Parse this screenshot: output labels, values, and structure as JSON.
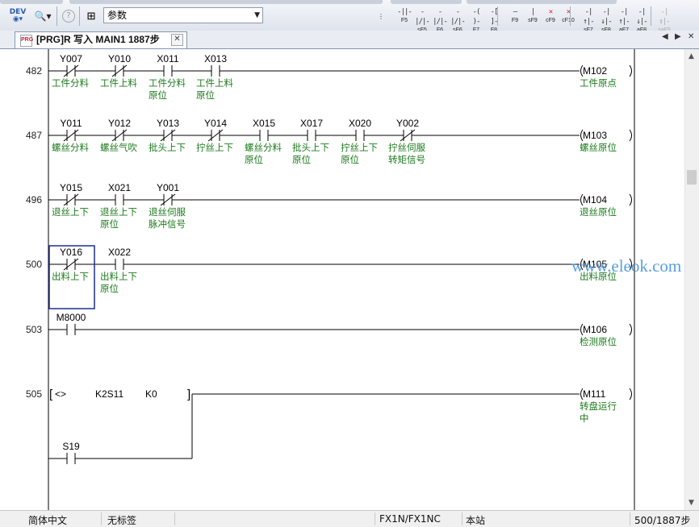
{
  "toolbar": {
    "device_icon_label": "DEV",
    "search_scope_value": "参数",
    "fkeys": [
      {
        "id": "f5",
        "label": "F5",
        "sym": "-||-"
      },
      {
        "id": "sf5",
        "label": "sF5",
        "sym": "-|/|-"
      },
      {
        "id": "f6",
        "label": "F6",
        "sym": "-|/|-"
      },
      {
        "id": "sf6",
        "label": "sF6",
        "sym": "-|/|-"
      },
      {
        "id": "f7",
        "label": "F7",
        "sym": "-( )-"
      },
      {
        "id": "f8",
        "label": "F8",
        "sym": "-[ ]-"
      },
      {
        "id": "f9",
        "label": "F9",
        "sym": "—"
      },
      {
        "id": "sf9",
        "label": "sF9",
        "sym": "|"
      },
      {
        "id": "cf9",
        "label": "cF9",
        "sym": "✕"
      },
      {
        "id": "cf10",
        "label": "cF10",
        "sym": "✕"
      },
      {
        "id": "sf7",
        "label": "sF7",
        "sym": "-|↑|-"
      },
      {
        "id": "sf8",
        "label": "sF8",
        "sym": "-|↓|-"
      },
      {
        "id": "af7",
        "label": "aF7",
        "sym": "-|↑|-"
      },
      {
        "id": "af8",
        "label": "aF8",
        "sym": "-|↓|-"
      },
      {
        "id": "saf5",
        "label": "saF5",
        "sym": "-|↕|-"
      }
    ]
  },
  "tab": {
    "title": "[PRG]R 写入 MAIN1 1887步"
  },
  "ladder": {
    "rungs": [
      {
        "step": "482",
        "coil": "M102",
        "coil_comment": [
          "工件原点"
        ],
        "contacts": [
          {
            "dev": "Y007",
            "nc": true,
            "comment": [
              "工件分料"
            ]
          },
          {
            "dev": "Y010",
            "nc": true,
            "comment": [
              "工件上料"
            ]
          },
          {
            "dev": "X011",
            "nc": false,
            "comment": [
              "工件分料",
              "原位"
            ]
          },
          {
            "dev": "X013",
            "nc": false,
            "comment": [
              "工件上料",
              "原位"
            ]
          }
        ]
      },
      {
        "step": "487",
        "coil": "M103",
        "coil_comment": [
          "螺丝原位"
        ],
        "contacts": [
          {
            "dev": "Y011",
            "nc": true,
            "comment": [
              "螺丝分料"
            ]
          },
          {
            "dev": "Y012",
            "nc": true,
            "comment": [
              "螺丝气吹"
            ]
          },
          {
            "dev": "Y013",
            "nc": true,
            "comment": [
              "批头上下"
            ]
          },
          {
            "dev": "Y014",
            "nc": true,
            "comment": [
              "拧丝上下"
            ]
          },
          {
            "dev": "X015",
            "nc": false,
            "comment": [
              "螺丝分料",
              "原位"
            ]
          },
          {
            "dev": "X017",
            "nc": false,
            "comment": [
              "批头上下",
              "原位"
            ]
          },
          {
            "dev": "X020",
            "nc": false,
            "comment": [
              "拧丝上下",
              "原位"
            ]
          },
          {
            "dev": "Y002",
            "nc": true,
            "comment": [
              "拧丝伺服",
              "转矩信号"
            ]
          }
        ]
      },
      {
        "step": "496",
        "coil": "M104",
        "coil_comment": [
          "退丝原位"
        ],
        "contacts": [
          {
            "dev": "Y015",
            "nc": true,
            "comment": [
              "退丝上下"
            ]
          },
          {
            "dev": "X021",
            "nc": false,
            "comment": [
              "退丝上下",
              "原位"
            ]
          },
          {
            "dev": "Y001",
            "nc": true,
            "comment": [
              "退丝伺服",
              "脉冲信号"
            ]
          }
        ]
      },
      {
        "step": "500",
        "coil": "M105",
        "coil_comment": [
          "出料原位"
        ],
        "contacts": [
          {
            "dev": "Y016",
            "nc": true,
            "comment": [
              "出料上下"
            ]
          },
          {
            "dev": "X022",
            "nc": false,
            "comment": [
              "出料上下",
              "原位"
            ]
          }
        ]
      },
      {
        "step": "503",
        "coil": "M106",
        "coil_comment": [
          "检测原位"
        ],
        "contacts": [
          {
            "dev": "M8000",
            "nc": false,
            "comment": []
          }
        ]
      },
      {
        "step": "505",
        "coil": "M111",
        "coil_comment": [
          "转盘运行",
          "中"
        ],
        "compare": {
          "op": "<>",
          "s1": "K2S11",
          "s2": "K0"
        },
        "parallel": {
          "dev": "S19",
          "nc": false
        }
      }
    ]
  },
  "watermark": "www.eleok.com",
  "status": {
    "ime": "简体中文",
    "label": "无标签",
    "plc": "FX1N/FX1NC",
    "station": "本站",
    "steps": "500/1887步"
  },
  "colors": {
    "device": "#000000",
    "comment": "#1b7a1b",
    "cursor": "#1d2f8f",
    "rail": "#000000"
  }
}
